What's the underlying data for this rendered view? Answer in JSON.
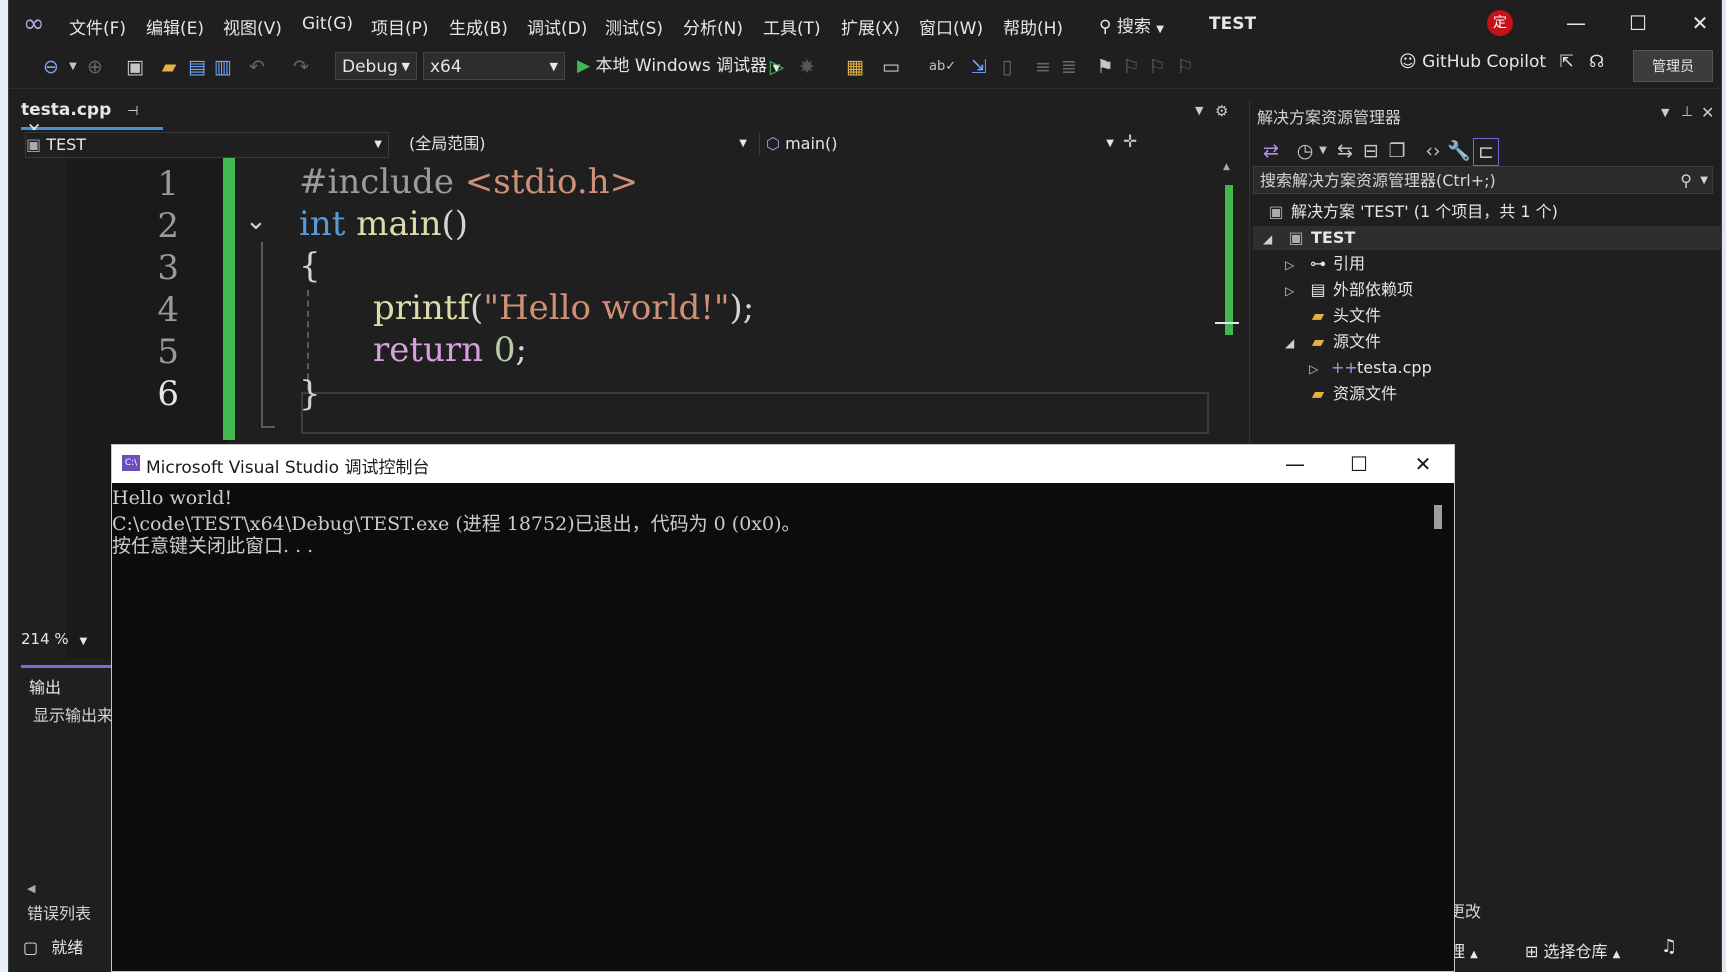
{
  "menu": {
    "items": [
      "文件(F)",
      "编辑(E)",
      "视图(V)",
      "Git(G)",
      "项目(P)",
      "生成(B)",
      "调试(D)",
      "测试(S)",
      "分析(N)",
      "工具(T)",
      "扩展(X)",
      "窗口(W)",
      "帮助(H)"
    ],
    "search": "搜索",
    "title": "TEST",
    "avatar": "定"
  },
  "toolbar": {
    "config": "Debug",
    "platform": "x64",
    "run_label": "本地 Windows 调试器",
    "copilot": "GitHub Copilot",
    "admin": "管理员"
  },
  "editor": {
    "tab": "testa.cpp",
    "nav_project": "TEST",
    "nav_scope": "(全局范围)",
    "nav_member": "main()",
    "line_numbers": [
      "1",
      "2",
      "3",
      "4",
      "5",
      "6"
    ],
    "lines": {
      "l1_pp": "#include",
      "l1_hdr": " <stdio.h>",
      "l2_kw": "int",
      "l2_fn": " main",
      "l2_rest": "()",
      "l3": "{",
      "l4_fn": "printf",
      "l4_open": "(",
      "l4_str": "\"Hello world!\"",
      "l4_close": ");",
      "l5_kw": "return",
      "l5_num": " 0",
      "l5_semi": ";",
      "l6": "}"
    },
    "zoom": "214 %"
  },
  "panels": {
    "output_title": "输出",
    "output_text": "显示输出来",
    "error_list": "错误列表",
    "status": "就绪"
  },
  "solution_explorer": {
    "title": "解决方案资源管理器",
    "search_placeholder": "搜索解决方案资源管理器(Ctrl+;)",
    "solution": "解决方案 'TEST' (1 个项目，共 1 个)",
    "project": "TEST",
    "items": [
      "引用",
      "外部依赖项",
      "头文件",
      "源文件",
      "testa.cpp",
      "资源文件"
    ],
    "bottom_text1": "更改",
    "bottom_text2": "理",
    "repo": "选择仓库"
  },
  "console": {
    "title": "Microsoft Visual Studio 调试控制台",
    "lines": [
      "Hello world!",
      "C:\\code\\TEST\\x64\\Debug\\TEST.exe (进程 18752)已退出，代码为 0 (0x0)。",
      "按任意键关闭此窗口. . ."
    ]
  }
}
